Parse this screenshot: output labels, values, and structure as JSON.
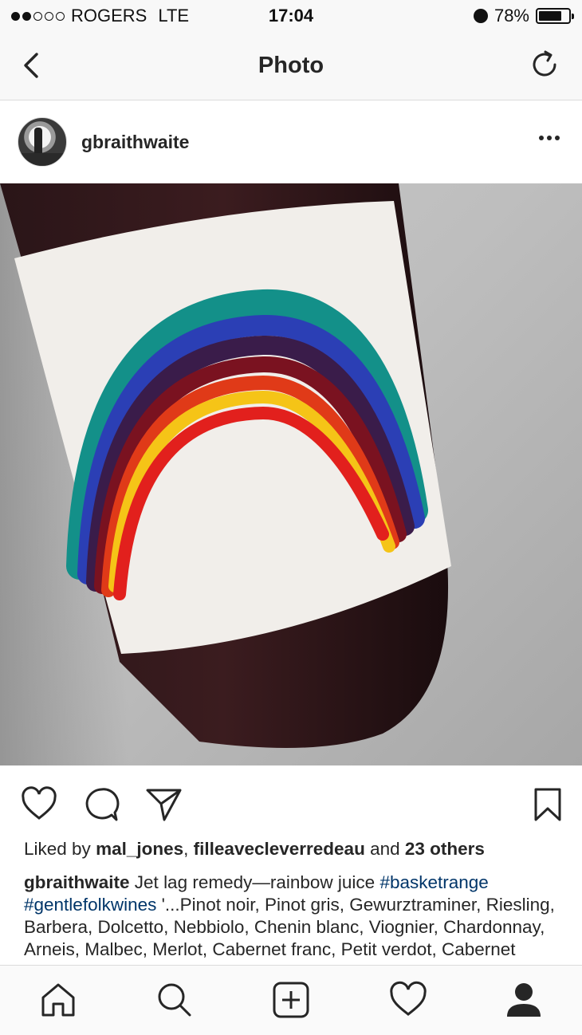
{
  "status_bar": {
    "carrier": "ROGERS",
    "network": "LTE",
    "time": "17:04",
    "battery": "78%",
    "battery_level": 0.78
  },
  "nav": {
    "title": "Photo"
  },
  "post": {
    "username": "gbraithwaite",
    "likes": {
      "prefix": "Liked by",
      "user1": "mal_jones",
      "separator": ",",
      "user2": "filleavecleverredeau",
      "connector": "and",
      "others": "23 others"
    },
    "caption": {
      "username": "gbraithwaite",
      "text1": "Jet lag remedy—rainbow juice",
      "tag1": "#basketrange",
      "tag2": "#gentlefolkwines",
      "text2": "'...Pinot noir, Pinot gris, Gewurztraminer, Riesling, Barbera, Dolcetto, Nebbiolo, Chenin blanc, Viognier, Chardonnay, Arneis, Malbec, Merlot, Cabernet franc, Petit verdot, Cabernet sauvignon, Sauvignon blanc"
    }
  },
  "colors": {
    "text": "#262626",
    "hashtag": "#003569",
    "divider": "#dbdbdb"
  },
  "icons": {
    "back": "chevron-left-icon",
    "refresh": "refresh-icon",
    "more": "more-horizontal-icon",
    "like": "heart-icon",
    "comment": "comment-icon",
    "share": "send-icon",
    "save": "bookmark-icon",
    "home": "home-icon",
    "search": "search-icon",
    "new_post": "plus-square-icon",
    "activity": "heart-icon",
    "profile": "profile-icon"
  }
}
